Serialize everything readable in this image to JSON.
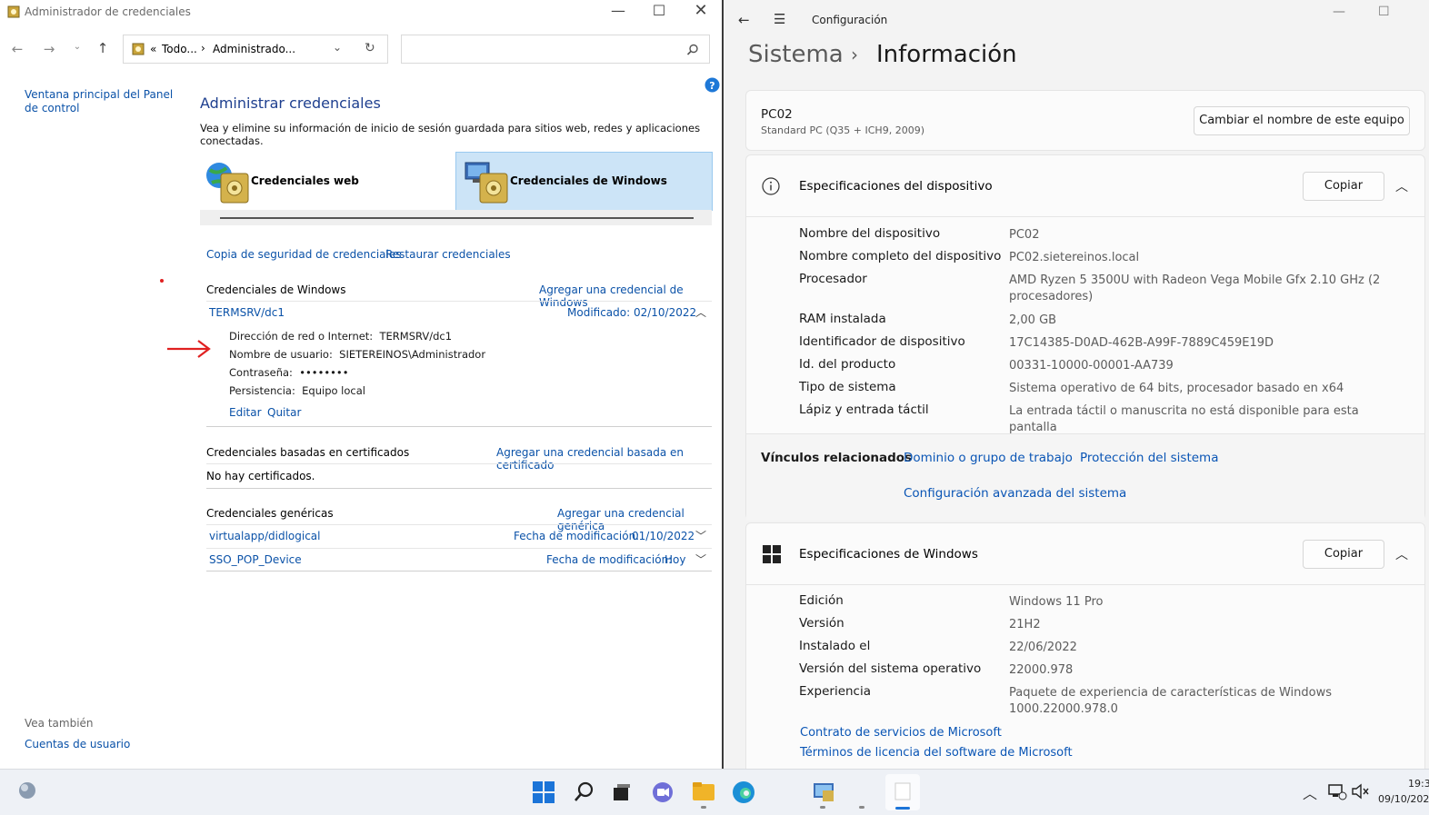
{
  "credman": {
    "title": "Administrador de credenciales",
    "address": {
      "chev": "«",
      "part1": "Todo...",
      "sep": "›",
      "part2": "Administrado..."
    },
    "sidebar_link": "Ventana principal del Panel de control",
    "heading": "Administrar credenciales",
    "subtitle": "Vea y elimine su información de inicio de sesión guardada para sitios web, redes y aplicaciones conectadas.",
    "tab_web": "Credenciales web",
    "tab_windows": "Credenciales de Windows",
    "backup": "Copia de seguridad de credenciales",
    "restore": "Restaurar credenciales",
    "win_section": {
      "title": "Credenciales de Windows",
      "add": "Agregar una credencial de Windows"
    },
    "entry": {
      "name": "TERMSRV/dc1",
      "modified": "Modificado:  02/10/2022",
      "address_label": "Dirección de red o Internet:",
      "address_value": "TERMSRV/dc1",
      "user_label": "Nombre de usuario:",
      "user_value": "SIETEREINOS\\Administrador",
      "pass_label": "Contraseña:",
      "pass_value": "••••••••",
      "persist_label": "Persistencia:",
      "persist_value": "Equipo local",
      "edit": "Editar",
      "remove": "Quitar"
    },
    "cert_section": {
      "title": "Credenciales basadas en certificados",
      "add": "Agregar una credencial basada en certificado",
      "empty": "No hay certificados."
    },
    "generic_section": {
      "title": "Credenciales genéricas",
      "add": "Agregar una credencial genérica",
      "items": [
        {
          "name": "virtualapp/didlogical",
          "date_label": "Fecha de modificación:",
          "date": "01/10/2022"
        },
        {
          "name": "SSO_POP_Device",
          "date_label": "Fecha de modificación:",
          "date": "Hoy"
        }
      ]
    },
    "see_also": "Vea también",
    "user_accounts": "Cuentas de usuario"
  },
  "settings": {
    "app_title": "Configuración",
    "breadcrumb_parent": "Sistema",
    "breadcrumb_sep": "›",
    "breadcrumb_current": "Información",
    "pc_name": "PC02",
    "pc_model": "Standard PC (Q35 + ICH9, 2009)",
    "rename_button": "Cambiar el nombre de este equipo",
    "device_specs": {
      "title": "Especificaciones del dispositivo",
      "copy": "Copiar",
      "rows": [
        {
          "label": "Nombre del dispositivo",
          "value": "PC02"
        },
        {
          "label": "Nombre completo del dispositivo",
          "value": "PC02.sietereinos.local"
        },
        {
          "label": "Procesador",
          "value": "AMD Ryzen 5 3500U with Radeon Vega Mobile Gfx     2.10 GHz  (2 procesadores)"
        },
        {
          "label": "RAM instalada",
          "value": "2,00 GB"
        },
        {
          "label": "Identificador de dispositivo",
          "value": "17C14385-D0AD-462B-A99F-7889C459E19D"
        },
        {
          "label": "Id. del producto",
          "value": "00331-10000-00001-AA739"
        },
        {
          "label": "Tipo de sistema",
          "value": "Sistema operativo de 64 bits, procesador basado en x64"
        },
        {
          "label": "Lápiz y entrada táctil",
          "value": "La entrada táctil o manuscrita no está disponible para esta pantalla"
        }
      ]
    },
    "related": {
      "label": "Vínculos relacionados",
      "links": [
        "Dominio o grupo de trabajo",
        "Protección del sistema",
        "Configuración avanzada del sistema"
      ]
    },
    "windows_specs": {
      "title": "Especificaciones de Windows",
      "copy": "Copiar",
      "rows": [
        {
          "label": "Edición",
          "value": "Windows 11 Pro"
        },
        {
          "label": "Versión",
          "value": "21H2"
        },
        {
          "label": "Instalado el",
          "value": "22/06/2022"
        },
        {
          "label": "Versión del sistema operativo",
          "value": "22000.978"
        },
        {
          "label": "Experiencia",
          "value": "Paquete de experiencia de características de Windows 1000.22000.978.0"
        }
      ],
      "links": [
        "Contrato de servicios de Microsoft",
        "Términos de licencia del software de Microsoft"
      ]
    }
  },
  "taskbar": {
    "time": "19:3",
    "date": "09/10/202"
  },
  "colors": {
    "link": "#0b52a8",
    "selected_tab": "#cce4f7",
    "annotation": "#e02020"
  }
}
